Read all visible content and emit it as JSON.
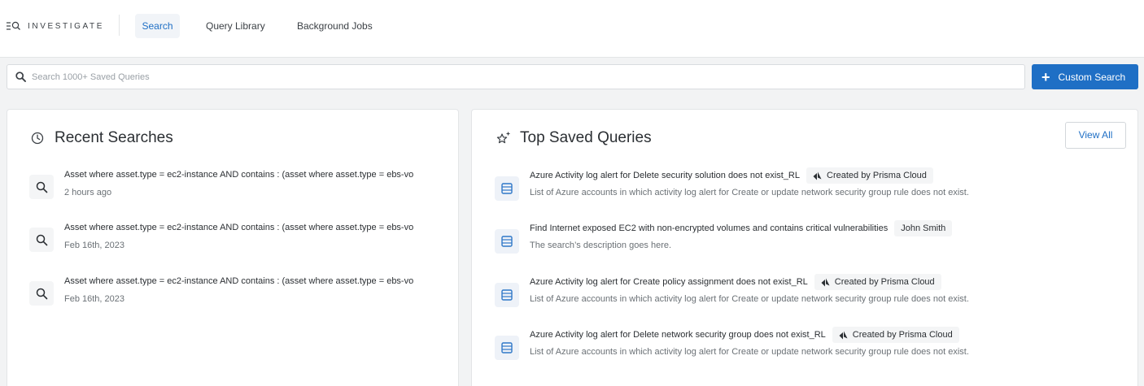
{
  "header": {
    "app_name": "INVESTIGATE",
    "tabs": [
      {
        "label": "Search",
        "active": true
      },
      {
        "label": "Query Library",
        "active": false
      },
      {
        "label": "Background Jobs",
        "active": false
      }
    ]
  },
  "search": {
    "placeholder": "Search 1000+ Saved Queries",
    "value": "",
    "custom_button_label": "Custom Search"
  },
  "recent": {
    "title": "Recent Searches",
    "items": [
      {
        "query": "Asset where asset.type = ec2-instance AND contains : (asset where asset.type = ebs-vo",
        "time": "2 hours ago"
      },
      {
        "query": "Asset where asset.type = ec2-instance AND contains : (asset where asset.type = ebs-vo",
        "time": "Feb 16th, 2023"
      },
      {
        "query": "Asset where asset.type = ec2-instance AND contains : (asset where asset.type = ebs-vo",
        "time": "Feb 16th, 2023"
      }
    ]
  },
  "saved": {
    "title": "Top Saved Queries",
    "view_all_label": "View All",
    "items": [
      {
        "title": "Azure Activity log alert for Delete security solution does not exist_RL",
        "creator": "Created by Prisma Cloud",
        "creator_icon": "prisma-logo-icon",
        "description": "List of Azure accounts in which activity log alert for Create or update network security group rule does not exist."
      },
      {
        "title": "Find Internet exposed EC2 with non-encrypted volumes and contains critical vulnerabilities",
        "creator": "John Smith",
        "creator_icon": "",
        "description": "The search’s description goes here."
      },
      {
        "title": "Azure Activity log alert for Create policy assignment does not exist_RL",
        "creator": "Created by Prisma Cloud",
        "creator_icon": "prisma-logo-icon",
        "description": "List of Azure accounts in which activity log alert for Create or update network security group rule does not exist."
      },
      {
        "title": "Azure Activity log alert for Delete network security group does not exist_RL",
        "creator": "Created by Prisma Cloud",
        "creator_icon": "prisma-logo-icon",
        "description": "List of Azure accounts in which activity log alert for Create or update network security group rule does not exist."
      }
    ]
  },
  "colors": {
    "accent": "#1f6fc5",
    "background": "#f2f3f4",
    "card": "#ffffff",
    "muted_text": "#6b7176"
  }
}
